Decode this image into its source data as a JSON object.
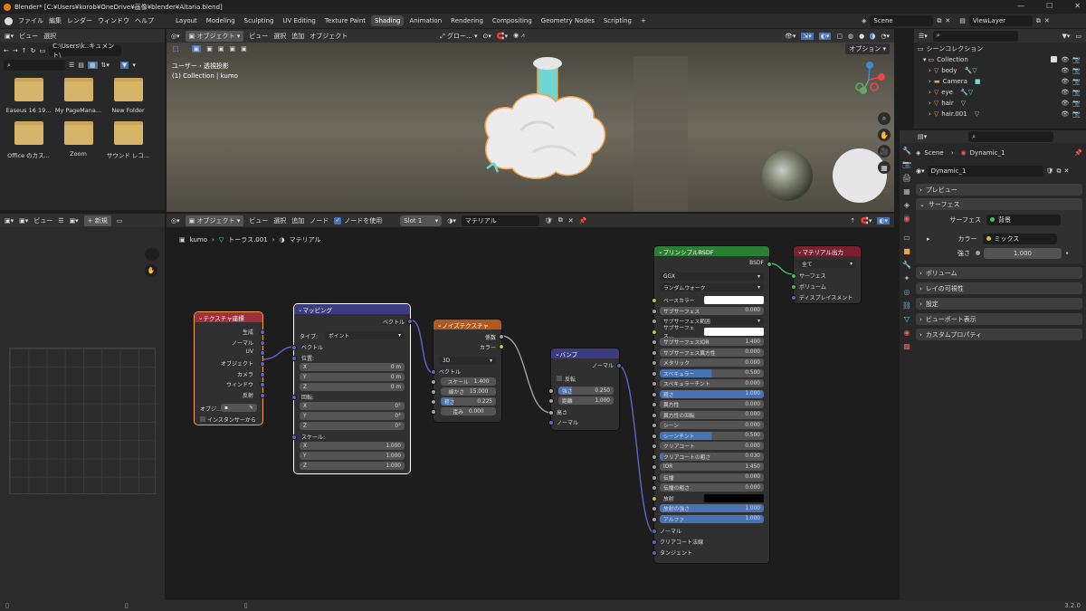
{
  "window": {
    "title": "Blender* [C:¥Users¥korob¥OneDrive¥画像¥blender¥Altaria.blend]"
  },
  "menu": {
    "items": [
      "ファイル",
      "編集",
      "レンダー",
      "ウィンドウ",
      "ヘルプ"
    ]
  },
  "workspaces": {
    "tabs": [
      "Layout",
      "Modeling",
      "Sculpting",
      "UV Editing",
      "Texture Paint",
      "Shading",
      "Animation",
      "Rendering",
      "Compositing",
      "Geometry Nodes",
      "Scripting"
    ],
    "active": "Shading"
  },
  "scene": {
    "name": "Scene",
    "view_layer": "ViewLayer"
  },
  "filebrowser": {
    "view": "ビュー",
    "select": "選択",
    "path": "C:\\Users\\k..キュメント\\",
    "items": [
      {
        "name": "Easeus 16 19..."
      },
      {
        "name": "My PageMana..."
      },
      {
        "name": "New Folder"
      },
      {
        "name": "Office のカス..."
      },
      {
        "name": "Zoom"
      },
      {
        "name": "サウンド レコ..."
      }
    ]
  },
  "viewport": {
    "mode": "オブジェクト",
    "menus": [
      "ビュー",
      "選択",
      "追加",
      "オブジェクト"
    ],
    "transform": "グロー...",
    "options": "オプション",
    "overlay_line1": "ユーザー・透視投影",
    "overlay_line2": "(1) Collection | kumo"
  },
  "image_editor": {
    "view": "ビュー",
    "new_label": "新規"
  },
  "node_editor": {
    "mode": "オブジェクト",
    "menus": [
      "ビュー",
      "選択",
      "追加",
      "ノード"
    ],
    "use_nodes": "ノードを使用",
    "slot": "Slot 1",
    "material_label": "マテリアル",
    "breadcrumb": [
      "kumo",
      "トーラス.001",
      "マテリアル"
    ]
  },
  "nodes": {
    "texcoord": {
      "title": "テクスチャ座標",
      "outputs": [
        "生成",
        "ノーマル",
        "UV",
        "オブジェクト",
        "カメラ",
        "ウィンドウ",
        "反射"
      ],
      "object_label": "オブジ...",
      "instancer": "インスタンサーから"
    },
    "mapping": {
      "title": "マッピング",
      "output": "ベクトル",
      "type_label": "タイプ:",
      "type_value": "ポイント",
      "vector": "ベクトル",
      "location": "位置:",
      "rotation": "回転:",
      "scale": "スケール:",
      "loc": [
        [
          "X",
          "0 m"
        ],
        [
          "Y",
          "0 m"
        ],
        [
          "Z",
          "0 m"
        ]
      ],
      "rot": [
        [
          "X",
          "0°"
        ],
        [
          "Y",
          "0°"
        ],
        [
          "Z",
          "0°"
        ]
      ],
      "scl": [
        [
          "X",
          "1.000"
        ],
        [
          "Y",
          "1.000"
        ],
        [
          "Z",
          "1.000"
        ]
      ]
    },
    "noise": {
      "title": "ノイズテクスチャ",
      "outputs": [
        "係数",
        "カラー"
      ],
      "dim": "3D",
      "vector": "ベクトル",
      "fields": [
        [
          "スケール",
          "1.400"
        ],
        [
          "細かさ",
          "15.000"
        ],
        [
          "粗さ",
          "0.225"
        ],
        [
          "歪み",
          "0.000"
        ]
      ]
    },
    "bump": {
      "title": "バンプ",
      "output": "ノーマル",
      "invert": "反転",
      "fields": [
        [
          "強さ",
          "0.250"
        ],
        [
          "距離",
          "1.000"
        ]
      ],
      "inputs": [
        "高さ",
        "ノーマル"
      ]
    },
    "bsdf": {
      "title": "プリンシプルBSDF",
      "output": "BSDF",
      "dist": "GGX",
      "sss": "ランダムウォーク",
      "rows": [
        [
          "ベースカラー",
          ""
        ],
        [
          "サブサーフェス",
          "0.000"
        ],
        [
          "サブサーフェス範囲",
          ""
        ],
        [
          "サブサーフェス...",
          ""
        ],
        [
          "サブサーフェスIOR",
          "1.400"
        ],
        [
          "サブサーフェス異方性",
          "0.000"
        ],
        [
          "メタリック",
          "0.000"
        ],
        [
          "スペキュラー",
          "0.500"
        ],
        [
          "スペキュラーチント",
          "0.000"
        ],
        [
          "粗さ",
          "1.000"
        ],
        [
          "異方性",
          "0.000"
        ],
        [
          "異方性の回転",
          "0.000"
        ],
        [
          "シーン",
          "0.000"
        ],
        [
          "シーンチント",
          "0.500"
        ],
        [
          "クリアコート",
          "0.000"
        ],
        [
          "クリアコートの粗さ",
          "0.030"
        ],
        [
          "IOR",
          "1.450"
        ],
        [
          "伝播",
          "0.000"
        ],
        [
          "伝播の粗さ",
          "0.000"
        ],
        [
          "放射",
          ""
        ],
        [
          "放射の強さ",
          "1.000"
        ],
        [
          "アルファ",
          "1.000"
        ]
      ],
      "tail": [
        "ノーマル",
        "クリアコート法線",
        "タンジェント"
      ]
    },
    "output": {
      "title": "マテリアル出力",
      "target": "全て",
      "inputs": [
        "サーフェス",
        "ボリューム",
        "ディスプレイスメント"
      ]
    }
  },
  "outliner": {
    "title": "シーンコレクション",
    "items": [
      "Collection",
      "body",
      "Camera",
      "eye",
      "hair",
      "hair.001"
    ]
  },
  "properties": {
    "scene": "Scene",
    "world": "Dynamic_1",
    "world_field": "Dynamic_1",
    "sections": [
      "プレビュー",
      "サーフェス",
      "ボリューム",
      "レイの可視性",
      "設定",
      "ビューポート表示",
      "カスタムプロパティ"
    ],
    "surface_label": "サーフェス",
    "surface_value": "背景",
    "color_label": "カラー",
    "color_value": "ミックス",
    "strength_label": "強さ",
    "strength_value": "1.000"
  },
  "statusbar": {
    "version": "3.2.0"
  },
  "colors": {
    "accent": "#4772b3",
    "active_tab": "#4a4a4a",
    "orange": "#f2a04a"
  }
}
